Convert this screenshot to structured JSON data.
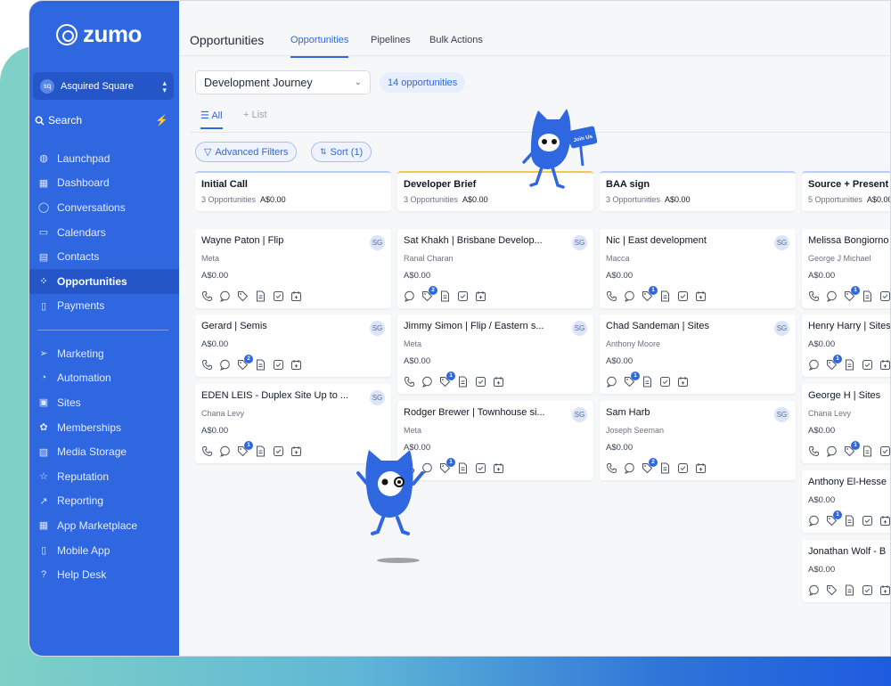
{
  "brand": {
    "name": "zumo"
  },
  "account": {
    "icon": "sq",
    "name": "Asquired Square"
  },
  "search": {
    "label": "Search"
  },
  "nav_primary": [
    {
      "label": "Launchpad",
      "icon": "rocket-icon"
    },
    {
      "label": "Dashboard",
      "icon": "grid-icon"
    },
    {
      "label": "Conversations",
      "icon": "chat-icon"
    },
    {
      "label": "Calendars",
      "icon": "calendar-icon"
    },
    {
      "label": "Contacts",
      "icon": "contacts-icon"
    },
    {
      "label": "Opportunities",
      "icon": "opportunities-icon",
      "active": true
    },
    {
      "label": "Payments",
      "icon": "payments-icon"
    }
  ],
  "nav_secondary": [
    {
      "label": "Marketing",
      "icon": "send-icon"
    },
    {
      "label": "Automation",
      "icon": "automation-icon"
    },
    {
      "label": "Sites",
      "icon": "sites-icon"
    },
    {
      "label": "Memberships",
      "icon": "membership-icon"
    },
    {
      "label": "Media Storage",
      "icon": "image-icon"
    },
    {
      "label": "Reputation",
      "icon": "star-icon"
    },
    {
      "label": "Reporting",
      "icon": "trend-icon"
    },
    {
      "label": "App Marketplace",
      "icon": "apps-icon"
    },
    {
      "label": "Mobile App",
      "icon": "phone-icon"
    },
    {
      "label": "Help Desk",
      "icon": "help-icon"
    }
  ],
  "header": {
    "title": "Opportunities",
    "tabs": [
      "Opportunities",
      "Pipelines",
      "Bulk Actions"
    ]
  },
  "pipeline": {
    "selected": "Development Journey",
    "count": "14 opportunities"
  },
  "views": {
    "all": "All",
    "list": "List"
  },
  "filters": {
    "advanced": "Advanced Filters",
    "sort": "Sort (1)"
  },
  "mascot": {
    "sign_text": "Join Us"
  },
  "stages": [
    {
      "name": "Initial Call",
      "count": "3 Opportunities",
      "amount": "A$0.00",
      "accent": "#b9cdf6"
    },
    {
      "name": "Developer Brief",
      "count": "3 Opportunities",
      "amount": "A$0.00",
      "accent": "#f2c94c"
    },
    {
      "name": "BAA sign",
      "count": "3 Opportunities",
      "amount": "A$0.00",
      "accent": "#b9cdf6"
    },
    {
      "name": "Source + Present",
      "count": "5 Opportunities",
      "amount": "A$0.00",
      "accent": "#b9cdf6"
    }
  ],
  "cards": [
    [
      {
        "title": "Wayne Paton | Flip",
        "sub": "Meta",
        "amount": "A$0.00",
        "avatar": "SG",
        "icons": [
          "phone",
          "chat",
          "tag",
          "doc",
          "check",
          "cal"
        ],
        "badges": {}
      },
      {
        "title": "Gerard | Semis",
        "sub": "",
        "amount": "A$0.00",
        "avatar": "SG",
        "icons": [
          "phone",
          "chat",
          "tag",
          "doc",
          "check",
          "cal"
        ],
        "badges": {
          "tag": "2"
        }
      },
      {
        "title": "EDEN LEIS - Duplex Site Up to ...",
        "sub": "Chana Levy",
        "amount": "A$0.00",
        "avatar": "SG",
        "icons": [
          "phone",
          "chat",
          "tag",
          "doc",
          "check",
          "cal"
        ],
        "badges": {
          "tag": "1"
        }
      }
    ],
    [
      {
        "title": "Sat Khakh | Brisbane Develop...",
        "sub": "Ranal Charan",
        "amount": "A$0.00",
        "avatar": "SG",
        "icons": [
          "chat",
          "tag",
          "doc",
          "check",
          "cal"
        ],
        "badges": {
          "tag": "2"
        }
      },
      {
        "title": "Jimmy Simon | Flip / Eastern s...",
        "sub": "Meta",
        "amount": "A$0.00",
        "avatar": "SG",
        "icons": [
          "phone",
          "chat",
          "tag",
          "doc",
          "check",
          "cal"
        ],
        "badges": {
          "tag": "1"
        }
      },
      {
        "title": "Rodger Brewer | Townhouse si...",
        "sub": "Meta",
        "amount": "A$0.00",
        "avatar": "SG",
        "icons": [
          "phone",
          "chat",
          "tag",
          "doc",
          "check",
          "cal"
        ],
        "badges": {
          "tag": "1"
        }
      }
    ],
    [
      {
        "title": "Nic | East development",
        "sub": "Macca",
        "amount": "A$0.00",
        "avatar": "SG",
        "icons": [
          "phone",
          "chat",
          "tag",
          "doc",
          "check",
          "cal"
        ],
        "badges": {
          "tag": "1"
        }
      },
      {
        "title": "Chad Sandeman | Sites",
        "sub": "Anthony Moore",
        "amount": "A$0.00",
        "avatar": "SG",
        "icons": [
          "chat",
          "tag",
          "doc",
          "check",
          "cal"
        ],
        "badges": {
          "tag": "1"
        }
      },
      {
        "title": "Sam Harb",
        "sub": "Joseph Seeman",
        "amount": "A$0.00",
        "avatar": "SG",
        "icons": [
          "phone",
          "chat",
          "tag",
          "doc",
          "check",
          "cal"
        ],
        "badges": {
          "tag": "2"
        }
      }
    ],
    [
      {
        "title": "Melissa Bongiorno",
        "sub": "George J Michael",
        "amount": "A$0.00",
        "avatar": "",
        "icons": [
          "phone",
          "chat",
          "tag",
          "doc",
          "check"
        ],
        "badges": {
          "tag": "1"
        }
      },
      {
        "title": "Henry Harry | Sites",
        "sub": "",
        "amount": "A$0.00",
        "avatar": "",
        "icons": [
          "chat",
          "tag",
          "doc",
          "check",
          "cal"
        ],
        "badges": {
          "tag": "1"
        }
      },
      {
        "title": "George H | Sites",
        "sub": "Chana Levy",
        "amount": "A$0.00",
        "avatar": "",
        "icons": [
          "phone",
          "chat",
          "tag",
          "doc",
          "check"
        ],
        "badges": {
          "tag": "1"
        }
      },
      {
        "title": "Anthony El-Hesse",
        "sub": "",
        "amount": "A$0.00",
        "avatar": "",
        "icons": [
          "chat",
          "tag",
          "doc",
          "check",
          "cal"
        ],
        "badges": {
          "tag": "1"
        }
      },
      {
        "title": "Jonathan Wolf - B",
        "sub": "",
        "amount": "A$0.00",
        "avatar": "",
        "icons": [
          "chat",
          "tag",
          "doc",
          "check",
          "cal"
        ],
        "badges": {}
      }
    ]
  ],
  "colors": {
    "sidebar": "#2f67e0",
    "accent": "#2f67e0",
    "teal": "#7fd0c6"
  }
}
